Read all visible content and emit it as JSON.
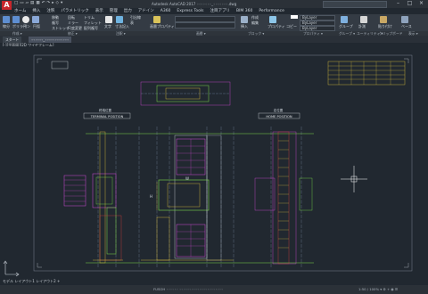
{
  "app": {
    "logo": "A",
    "title": "Autodesk AutoCAD 2017  ◦◦◦◦◦◦◦_◦◦◦◦◦◦◦.dwg",
    "quick_access": "□ ▭ ▱ ▤ ▦ ↶ ↷ ▸ ◇ ▾"
  },
  "window_controls": {
    "minimize": "–",
    "maximize": "□",
    "close": "×"
  },
  "menu": [
    "ホーム",
    "挿入",
    "注釈",
    "パラメトリック",
    "表示",
    "管理",
    "出力",
    "アドイン",
    "A360",
    "Express Tools",
    "注目アプリ",
    "BIM 360",
    "Performance"
  ],
  "ribbon": {
    "groups": [
      "作成",
      "修正",
      "注釈",
      "画層",
      "ブロック",
      "プロパティ",
      "グループ",
      "ユーティリティ",
      "クリップボード",
      "表示"
    ],
    "labels": [
      "線分",
      "ポリライン",
      "円",
      "円弧",
      "移動",
      "回転",
      "トリム",
      "複写",
      "ミラー",
      "フィレット",
      "ストレッチ",
      "尺度変更",
      "配列複写",
      "文字",
      "寸法記入",
      "引出線",
      "表",
      "画層プロパティ",
      "挿入",
      "作成",
      "編集",
      "プロパティ コピー",
      "グループ",
      "計測",
      "貼り付け",
      "ベース"
    ],
    "bylayer": [
      "ByLayer",
      "ByLayer",
      "ByLayer"
    ]
  },
  "panel_labels": [
    "作成 ▾",
    "修正 ▾",
    "注釈 ▾",
    "画層 ▾",
    "ブロック ▾",
    "プロパティ ▾",
    "グループ ▾",
    "ユーティリティ ▾",
    "クリップボード",
    "表示 ▾"
  ],
  "doc_tabs": [
    {
      "label": "スタート",
      "active": false
    },
    {
      "label": "◦◦◦◦◦◦_◦◦◦◦◦◦◦◦◦◦◦◦",
      "active": true
    }
  ],
  "viewport_label": "[-][平面図][2D ワイヤフレーム]",
  "drawing": {
    "label_left": "TERMINAL POSITION",
    "label_right": "HOME POSITION",
    "label_left_jp": "終端位置",
    "label_right_jp": "定位置",
    "dim_text": "W",
    "dim_h": "H"
  },
  "layout_tabs": [
    "モデル",
    "レイアウト1",
    "レイアウト2",
    "+"
  ],
  "status": {
    "left": "FUSOH ◦◦◦◦◦◦  ◦◦◦◦◦◦◦◦◦◦◦◦◦◦◦◦◦◦◦◦◦◦",
    "right": "1:50 / 100%  ▾  ⚙  +  ◉  ☰"
  },
  "colors": {
    "bg": "#212830",
    "accent_green": "#7cd94a",
    "magenta": "#d24ad6",
    "yellow": "#e6c63c"
  }
}
